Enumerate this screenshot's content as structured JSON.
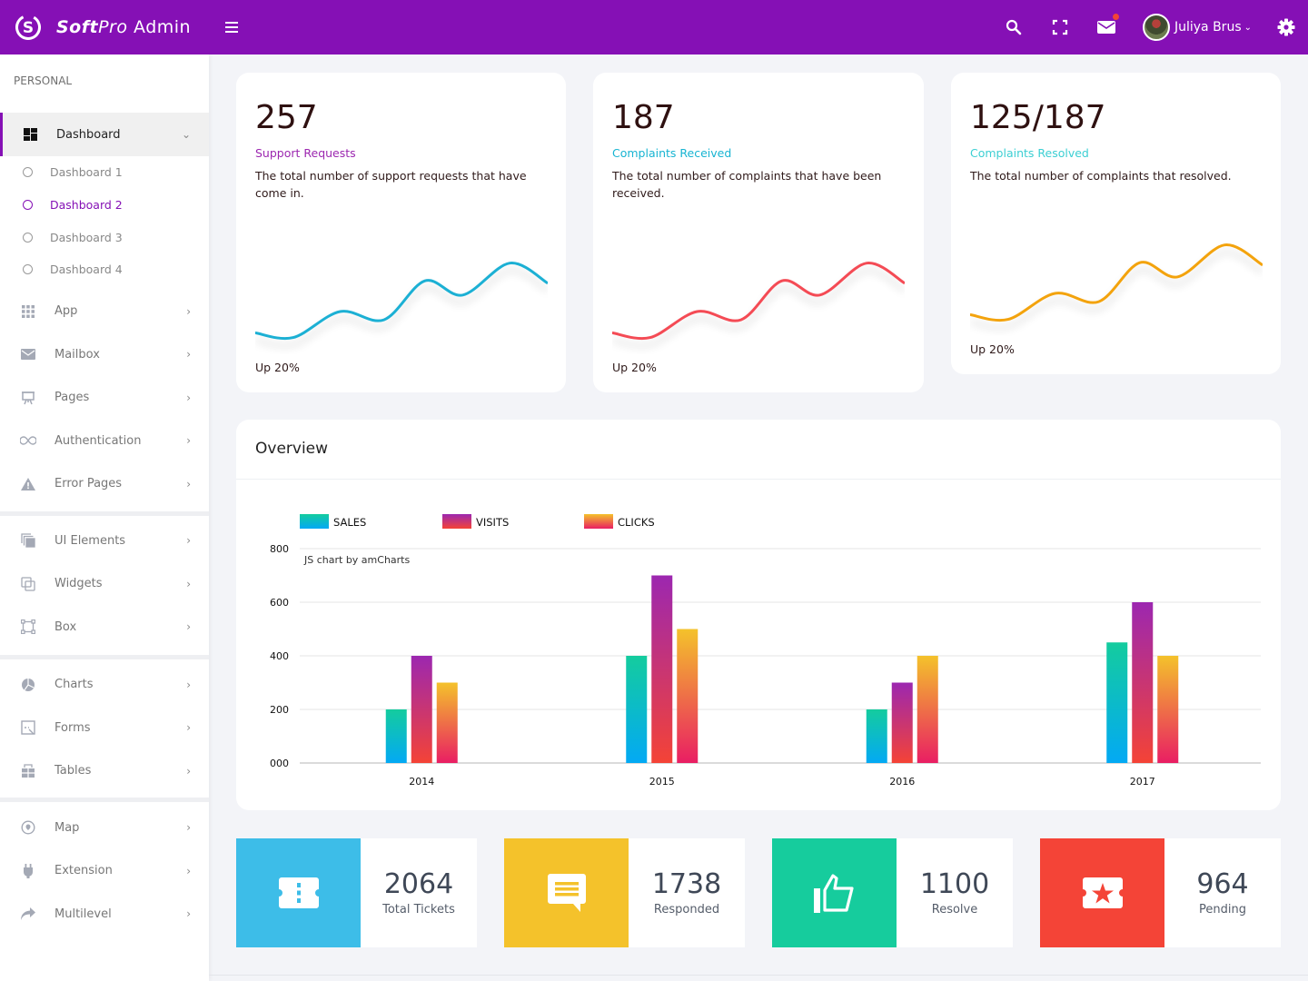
{
  "header": {
    "brand_bold": "Soft",
    "brand_italic": "Pro",
    "brand_rest": " Admin",
    "icons": [
      "search-icon",
      "fullscreen-icon",
      "mail-icon",
      "gear-icon"
    ],
    "user_name": "Juliya Brus",
    "has_notification": true
  },
  "sidebar": {
    "section": "PERSONAL",
    "dashboard": {
      "label": "Dashboard",
      "icon": "dashboard-icon"
    },
    "sub_items": [
      {
        "label": "Dashboard 1",
        "current": false
      },
      {
        "label": "Dashboard 2",
        "current": true
      },
      {
        "label": "Dashboard 3",
        "current": false
      },
      {
        "label": "Dashboard 4",
        "current": false
      }
    ],
    "group1": [
      {
        "label": "App",
        "icon": "apps-grid-icon"
      },
      {
        "label": "Mailbox",
        "icon": "mail-icon"
      },
      {
        "label": "Pages",
        "icon": "easel-icon"
      },
      {
        "label": "Authentication",
        "icon": "infinity-icon"
      },
      {
        "label": "Error Pages",
        "icon": "warning-icon"
      }
    ],
    "group2": [
      {
        "label": "UI Elements",
        "icon": "layers-icon"
      },
      {
        "label": "Widgets",
        "icon": "widgets-icon"
      },
      {
        "label": "Box",
        "icon": "box-icon"
      }
    ],
    "group3": [
      {
        "label": "Charts",
        "icon": "pie-chart-icon"
      },
      {
        "label": "Forms",
        "icon": "form-icon"
      },
      {
        "label": "Tables",
        "icon": "table-icon"
      }
    ],
    "group4": [
      {
        "label": "Map",
        "icon": "map-pin-icon"
      },
      {
        "label": "Extension",
        "icon": "plug-icon"
      },
      {
        "label": "Multilevel",
        "icon": "share-arrow-icon"
      }
    ]
  },
  "kpis": [
    {
      "value": "257",
      "title": "Support Requests",
      "title_color": "#9c27b0",
      "description": "The total number of support requests that have come in.",
      "footer": "Up 20%",
      "line_color": "#1cb0d4",
      "trend": [
        3.2,
        2.8,
        5.0,
        4.3,
        7.6,
        6.4,
        9.1,
        7.4
      ]
    },
    {
      "value": "187",
      "title": "Complaints Received",
      "title_color": "#17b4d2",
      "description": "The total number of complaints that have been received.",
      "footer": "Up 20%",
      "line_color": "#f44b54",
      "trend": [
        3.2,
        2.8,
        5.0,
        4.3,
        7.6,
        6.4,
        9.1,
        7.4
      ]
    },
    {
      "value": "125/187",
      "title": "Complaints Resolved",
      "title_color": "#3ccfd3",
      "description": "The total number of complaints that resolved.",
      "footer": "Up 20%",
      "line_color": "#f3a30f",
      "trend": [
        3.2,
        2.8,
        5.0,
        4.3,
        7.6,
        6.4,
        9.1,
        7.4
      ]
    }
  ],
  "overview": {
    "title": "Overview",
    "credit": "JS chart by amCharts"
  },
  "chart_data": {
    "type": "bar",
    "title": "Overview",
    "categories": [
      "2014",
      "2015",
      "2016",
      "2017"
    ],
    "series": [
      {
        "name": "SALES",
        "values": [
          200,
          400,
          200,
          450
        ],
        "gradient": [
          "#14cc9e",
          "#03a9f4"
        ]
      },
      {
        "name": "VISITS",
        "values": [
          400,
          700,
          300,
          600
        ],
        "gradient": [
          "#9c27b0",
          "#f44336"
        ]
      },
      {
        "name": "CLICKS",
        "values": [
          300,
          500,
          400,
          400
        ],
        "gradient": [
          "#f4c22b",
          "#e91e63"
        ]
      }
    ],
    "yticks": [
      "000",
      "200",
      "400",
      "600",
      "800"
    ],
    "ylim": [
      0,
      800
    ],
    "xlabel": "",
    "ylabel": "",
    "grid": true,
    "legend": "top-left"
  },
  "stats": [
    {
      "value": "2064",
      "label": "Total Tickets",
      "color": "#3dbde8",
      "icon": "ticket-icon"
    },
    {
      "value": "1738",
      "label": "Responded",
      "color": "#f4c22b",
      "icon": "chat-message-icon"
    },
    {
      "value": "1100",
      "label": "Resolve",
      "color": "#16cc9d",
      "icon": "thumbs-up-icon"
    },
    {
      "value": "964",
      "label": "Pending",
      "color": "#f44437",
      "icon": "star-ticket-icon"
    }
  ]
}
